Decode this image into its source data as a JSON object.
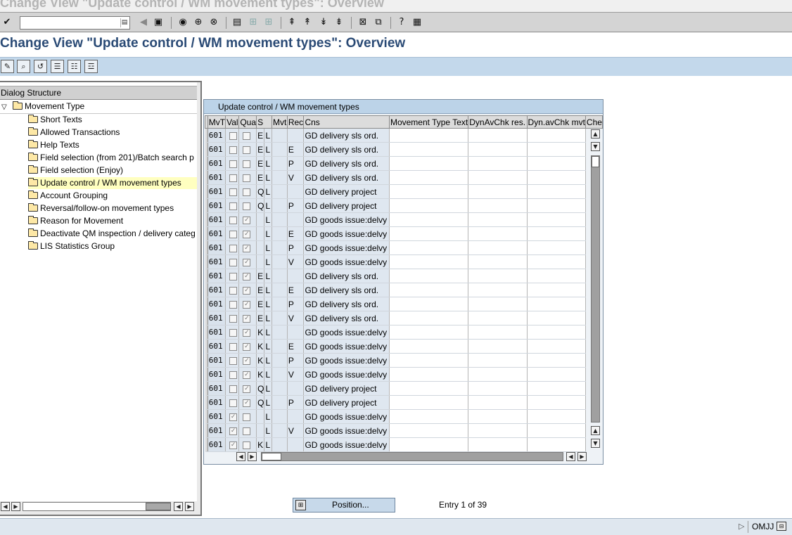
{
  "window": {
    "title": "Change View \"Update control / WM movement types\": Overview"
  },
  "page": {
    "title": "Change View \"Update control / WM movement types\": Overview"
  },
  "toolbar": {
    "command_field_value": "",
    "icons": [
      "enter-icon",
      "back-arrow-icon",
      "save-icon",
      "back-icon",
      "exit-icon",
      "cancel-icon",
      "print-icon",
      "find-icon",
      "find-next-icon",
      "first-page-icon",
      "previous-page-icon",
      "next-page-icon",
      "last-page-icon",
      "new-session-icon",
      "shortcut-icon",
      "help-icon",
      "layout-icon"
    ]
  },
  "app_toolbar": {
    "icons": [
      "change-display-icon",
      "details-icon",
      "undo-icon",
      "select-all-icon",
      "select-block-icon",
      "deselect-all-icon"
    ]
  },
  "dialog_structure": {
    "header": "Dialog Structure",
    "root": "Movement Type",
    "items": [
      "Short Texts",
      "Allowed Transactions",
      "Help Texts",
      "Field selection (from 201)/Batch search p",
      "Field selection (Enjoy)",
      "Update control / WM movement types",
      "Account Grouping",
      "Reversal/follow-on movement types",
      "Reason for Movement",
      "Deactivate QM inspection / delivery categ",
      "LIS Statistics Group"
    ],
    "selected_index": 5
  },
  "table": {
    "title": "Update control / WM movement types",
    "columns": [
      "MvT",
      "Val",
      "Qua",
      "S",
      "Mvt",
      "Rec",
      "Cns",
      "Movement Type Text",
      "DynAvChk res.",
      "Dyn.avChk mvt",
      "Che"
    ],
    "rows": [
      {
        "mvt": "601",
        "val": false,
        "qua": false,
        "s": "E",
        "m": "L",
        "cns": "",
        "text": "GD delivery sls ord."
      },
      {
        "mvt": "601",
        "val": false,
        "qua": false,
        "s": "E",
        "m": "L",
        "cns": "E",
        "text": "GD delivery sls ord."
      },
      {
        "mvt": "601",
        "val": false,
        "qua": false,
        "s": "E",
        "m": "L",
        "cns": "P",
        "text": "GD delivery sls ord."
      },
      {
        "mvt": "601",
        "val": false,
        "qua": false,
        "s": "E",
        "m": "L",
        "cns": "V",
        "text": "GD delivery sls ord."
      },
      {
        "mvt": "601",
        "val": false,
        "qua": false,
        "s": "Q",
        "m": "L",
        "cns": "",
        "text": "GD delivery project"
      },
      {
        "mvt": "601",
        "val": false,
        "qua": false,
        "s": "Q",
        "m": "L",
        "cns": "P",
        "text": "GD delivery project"
      },
      {
        "mvt": "601",
        "val": false,
        "qua": true,
        "s": "",
        "m": "L",
        "cns": "",
        "text": "GD goods issue:delvy"
      },
      {
        "mvt": "601",
        "val": false,
        "qua": true,
        "s": "",
        "m": "L",
        "cns": "E",
        "text": "GD goods issue:delvy"
      },
      {
        "mvt": "601",
        "val": false,
        "qua": true,
        "s": "",
        "m": "L",
        "cns": "P",
        "text": "GD goods issue:delvy"
      },
      {
        "mvt": "601",
        "val": false,
        "qua": true,
        "s": "",
        "m": "L",
        "cns": "V",
        "text": "GD goods issue:delvy"
      },
      {
        "mvt": "601",
        "val": false,
        "qua": true,
        "s": "E",
        "m": "L",
        "cns": "",
        "text": "GD delivery sls ord."
      },
      {
        "mvt": "601",
        "val": false,
        "qua": true,
        "s": "E",
        "m": "L",
        "cns": "E",
        "text": "GD delivery sls ord."
      },
      {
        "mvt": "601",
        "val": false,
        "qua": true,
        "s": "E",
        "m": "L",
        "cns": "P",
        "text": "GD delivery sls ord."
      },
      {
        "mvt": "601",
        "val": false,
        "qua": true,
        "s": "E",
        "m": "L",
        "cns": "V",
        "text": "GD delivery sls ord."
      },
      {
        "mvt": "601",
        "val": false,
        "qua": true,
        "s": "K",
        "m": "L",
        "cns": "",
        "text": "GD goods issue:delvy"
      },
      {
        "mvt": "601",
        "val": false,
        "qua": true,
        "s": "K",
        "m": "L",
        "cns": "E",
        "text": "GD goods issue:delvy"
      },
      {
        "mvt": "601",
        "val": false,
        "qua": true,
        "s": "K",
        "m": "L",
        "cns": "P",
        "text": "GD goods issue:delvy"
      },
      {
        "mvt": "601",
        "val": false,
        "qua": true,
        "s": "K",
        "m": "L",
        "cns": "V",
        "text": "GD goods issue:delvy"
      },
      {
        "mvt": "601",
        "val": false,
        "qua": true,
        "s": "Q",
        "m": "L",
        "cns": "",
        "text": "GD delivery project"
      },
      {
        "mvt": "601",
        "val": false,
        "qua": true,
        "s": "Q",
        "m": "L",
        "cns": "P",
        "text": "GD delivery project"
      },
      {
        "mvt": "601",
        "val": true,
        "qua": false,
        "s": "",
        "m": "L",
        "cns": "",
        "text": "GD goods issue:delvy"
      },
      {
        "mvt": "601",
        "val": true,
        "qua": false,
        "s": "",
        "m": "L",
        "cns": "V",
        "text": "GD goods issue:delvy"
      },
      {
        "mvt": "601",
        "val": true,
        "qua": false,
        "s": "K",
        "m": "L",
        "cns": "",
        "text": "GD goods issue:delvy"
      }
    ]
  },
  "footer": {
    "position_button": "Position...",
    "entry_info": "Entry 1 of 39"
  },
  "status": {
    "transaction": "OMJJ"
  }
}
